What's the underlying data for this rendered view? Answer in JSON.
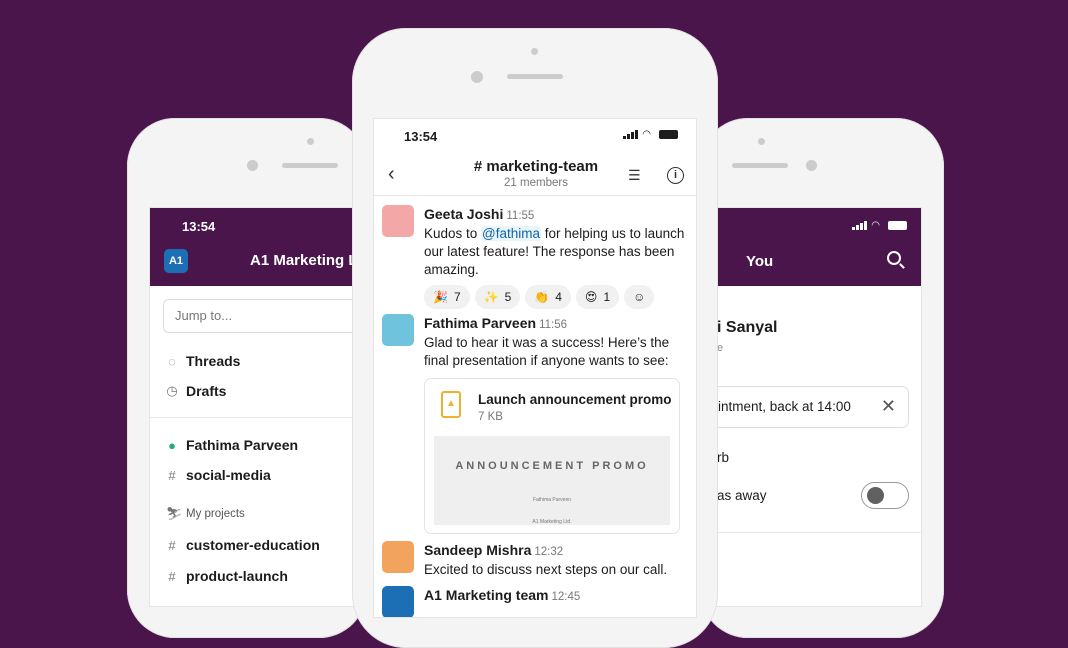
{
  "colors": {
    "brand": "#4a154b",
    "mention": "#1264a3",
    "presence": "#2bac76",
    "file_icon": "#ecb22e"
  },
  "left_phone": {
    "time": "13:54",
    "workspace_badge": "A1",
    "workspace_name": "A1 Marketing L",
    "jump_placeholder": "Jump to...",
    "items": [
      {
        "icon": "threads-icon",
        "label": "Threads"
      },
      {
        "icon": "drafts-icon",
        "label": "Drafts"
      }
    ],
    "channels": [
      {
        "icon": "presence-icon",
        "label": "Fathima Parveen"
      },
      {
        "icon": "hash-icon",
        "label": "social-media"
      }
    ],
    "section": "My projects",
    "project_channels": [
      {
        "icon": "hash-icon",
        "label": "customer-education"
      },
      {
        "icon": "hash-icon",
        "label": "product-launch"
      }
    ]
  },
  "center_phone": {
    "time": "13:54",
    "channel": "# marketing-team",
    "members": "21 members",
    "messages": [
      {
        "name": "Geeta Joshi",
        "time": "11:55",
        "text_before": "Kudos to ",
        "mention": "@fathima",
        "text_after": " for helping us to launch our latest feature! The response has been amazing.",
        "reactions": [
          {
            "emoji": "🎉",
            "count": "7"
          },
          {
            "emoji": "✨",
            "count": "5"
          },
          {
            "emoji": "👏",
            "count": "4"
          },
          {
            "emoji": "😍",
            "count": "1"
          }
        ]
      },
      {
        "name": "Fathima Parveen",
        "time": "11:56",
        "text": "Glad to hear it was a success! Here’s the final presentation if anyone wants to see:",
        "file": {
          "name": "Launch announcement promo",
          "size": "7 KB",
          "preview_title": "ANNOUNCEMENT PROMO",
          "preview_line1": "Fathima Parveen",
          "preview_line2": "A1 Marketing Ltd."
        }
      },
      {
        "name": "Sandeep Mishra",
        "time": "12:32",
        "text": "Excited to discuss next steps on our call."
      },
      {
        "name": "A1 Marketing team",
        "time": "12:45"
      }
    ]
  },
  "right_phone": {
    "title": "You",
    "user_name": "i Sanyal",
    "user_sub": "e",
    "status": "intment, back at 14:00",
    "dnd": "rb",
    "away_label": "as away",
    "away_toggle": false
  }
}
